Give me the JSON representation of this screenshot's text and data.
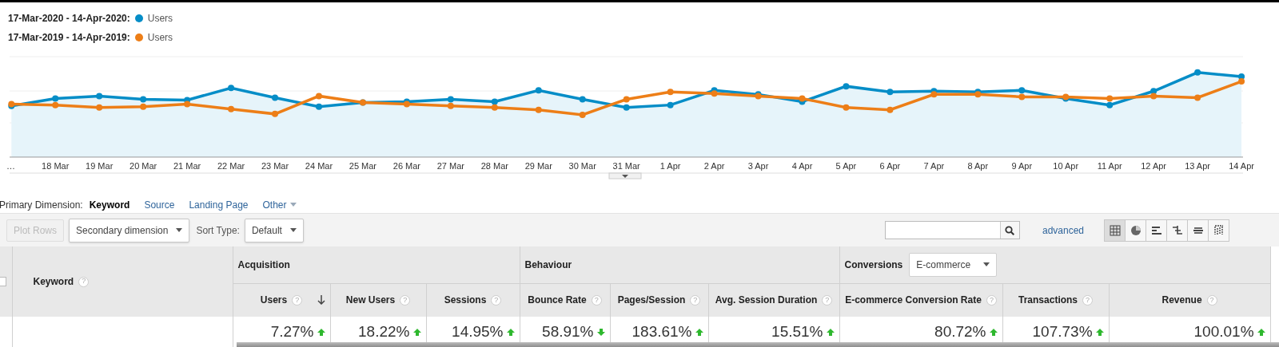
{
  "legend": [
    {
      "range": "17-Mar-2020 - 14-Apr-2020:",
      "metric": "Users",
      "color": "#058dc7"
    },
    {
      "range": "17-Mar-2019 - 14-Apr-2019:",
      "metric": "Users",
      "color": "#ed7e17"
    }
  ],
  "chart": {
    "x_labels": [
      "…",
      "18 Mar",
      "19 Mar",
      "20 Mar",
      "21 Mar",
      "22 Mar",
      "23 Mar",
      "24 Mar",
      "25 Mar",
      "26 Mar",
      "27 Mar",
      "28 Mar",
      "29 Mar",
      "30 Mar",
      "31 Mar",
      "1 Apr",
      "2 Apr",
      "3 Apr",
      "4 Apr",
      "5 Apr",
      "6 Apr",
      "7 Apr",
      "8 Apr",
      "9 Apr",
      "10 Apr",
      "11 Apr",
      "12 Apr",
      "13 Apr",
      "14 Apr"
    ]
  },
  "primary_dimension": {
    "label": "Primary Dimension:",
    "options": [
      {
        "label": "Keyword",
        "selected": true,
        "menu": false
      },
      {
        "label": "Source",
        "selected": false,
        "menu": false
      },
      {
        "label": "Landing Page",
        "selected": false,
        "menu": false
      },
      {
        "label": "Other",
        "selected": false,
        "menu": true
      }
    ]
  },
  "toolbar": {
    "plot_rows": {
      "label": "Plot Rows",
      "disabled": true
    },
    "secondary_dimension": "Secondary dimension",
    "sort_label": "Sort Type:",
    "sort_value": "Default",
    "advanced": "advanced",
    "views": [
      {
        "kind": "grid",
        "selected": true
      },
      {
        "kind": "pie",
        "selected": false
      },
      {
        "kind": "bars",
        "selected": false
      },
      {
        "kind": "branches",
        "selected": false
      },
      {
        "kind": "stack",
        "selected": false
      },
      {
        "kind": "columns",
        "selected": false
      }
    ]
  },
  "table": {
    "dimension": {
      "label": "Keyword",
      "help": "?"
    },
    "select_all": {
      "checked": false
    },
    "groups": [
      {
        "label": "Acquisition"
      },
      {
        "label": "Behaviour"
      },
      {
        "label": "Conversions",
        "dropdown": "E-commerce"
      }
    ],
    "columns": [
      {
        "label": "Users",
        "help": "?",
        "sorted": true
      },
      {
        "label": "New Users",
        "help": "?",
        "sorted": false
      },
      {
        "label": "Sessions",
        "help": "?",
        "sorted": false
      },
      {
        "label": "Bounce Rate",
        "help": "?",
        "sorted": false
      },
      {
        "label": "Pages/Session",
        "help": "?",
        "sorted": false
      },
      {
        "label": "Avg. Session Duration",
        "help": "?",
        "sorted": false
      },
      {
        "label": "E-commerce Conversion Rate",
        "help": "?",
        "sorted": false
      },
      {
        "label": "Transactions",
        "help": "?",
        "sorted": false
      },
      {
        "label": "Revenue",
        "help": "?",
        "sorted": false
      }
    ],
    "summary": [
      {
        "value": "7.27%",
        "up": true
      },
      {
        "value": "18.22%",
        "up": true
      },
      {
        "value": "14.95%",
        "up": true
      },
      {
        "value": "58.91%",
        "up": false
      },
      {
        "value": "183.61%",
        "up": true
      },
      {
        "value": "15.51%",
        "up": true
      },
      {
        "value": "80.72%",
        "up": true
      },
      {
        "value": "107.73%",
        "up": true
      },
      {
        "value": "100.01%",
        "up": true
      }
    ]
  }
}
